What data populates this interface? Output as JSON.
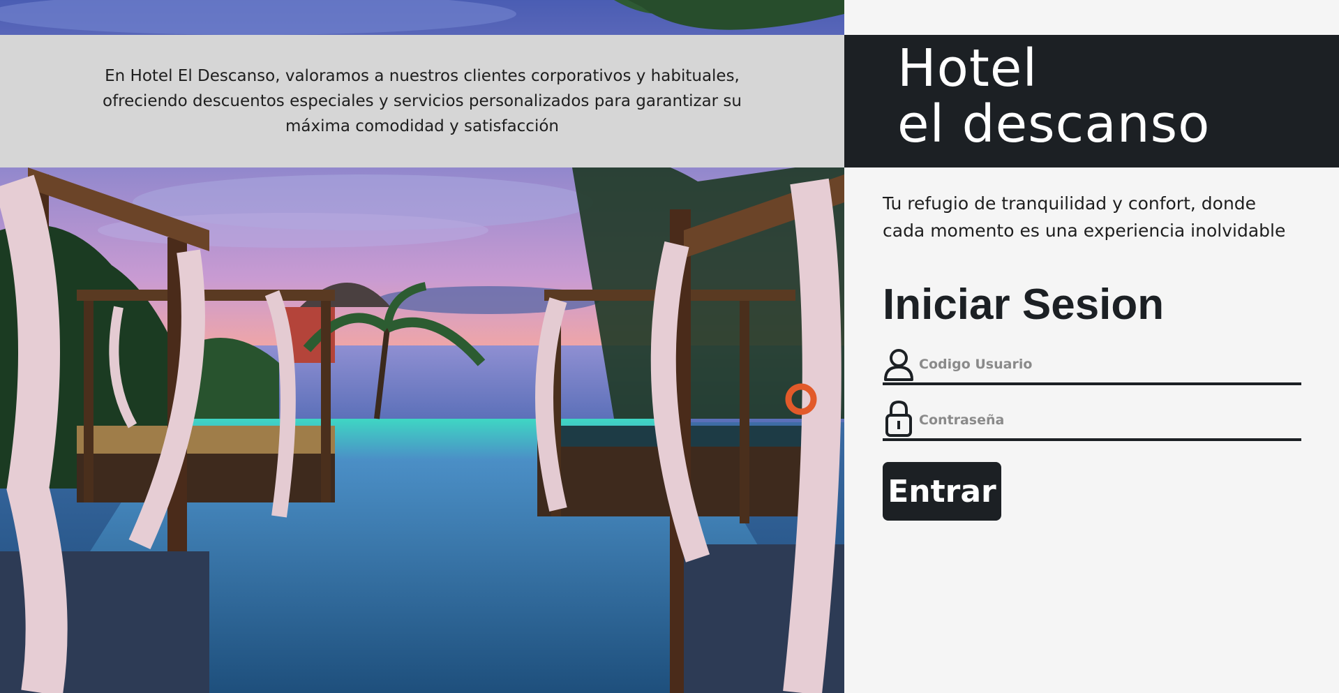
{
  "hero": {
    "image_description": "Infinity pool at dusk with curtained cabanas and palm trees",
    "info_text": "En Hotel El Descanso, valoramos a nuestros clientes corporativos y habituales, ofreciendo descuentos especiales y servicios personalizados para garantizar su máxima comodidad y satisfacción"
  },
  "brand": {
    "line1": "Hotel",
    "line2": "el descanso"
  },
  "tagline": "Tu refugio de tranquilidad y confort, donde cada momento es una experiencia inolvidable",
  "login": {
    "title": "Iniciar Sesion",
    "user_placeholder": "Codigo Usuario",
    "user_value": "",
    "password_placeholder": "Contraseña",
    "password_value": "",
    "submit_label": "Entrar"
  },
  "icons": {
    "user": "user-icon",
    "password": "lock-icon"
  },
  "colors": {
    "dark": "#1c2024",
    "band": "#d6d6d6",
    "background": "#f5f5f5",
    "placeholder": "#8a8a8a"
  }
}
